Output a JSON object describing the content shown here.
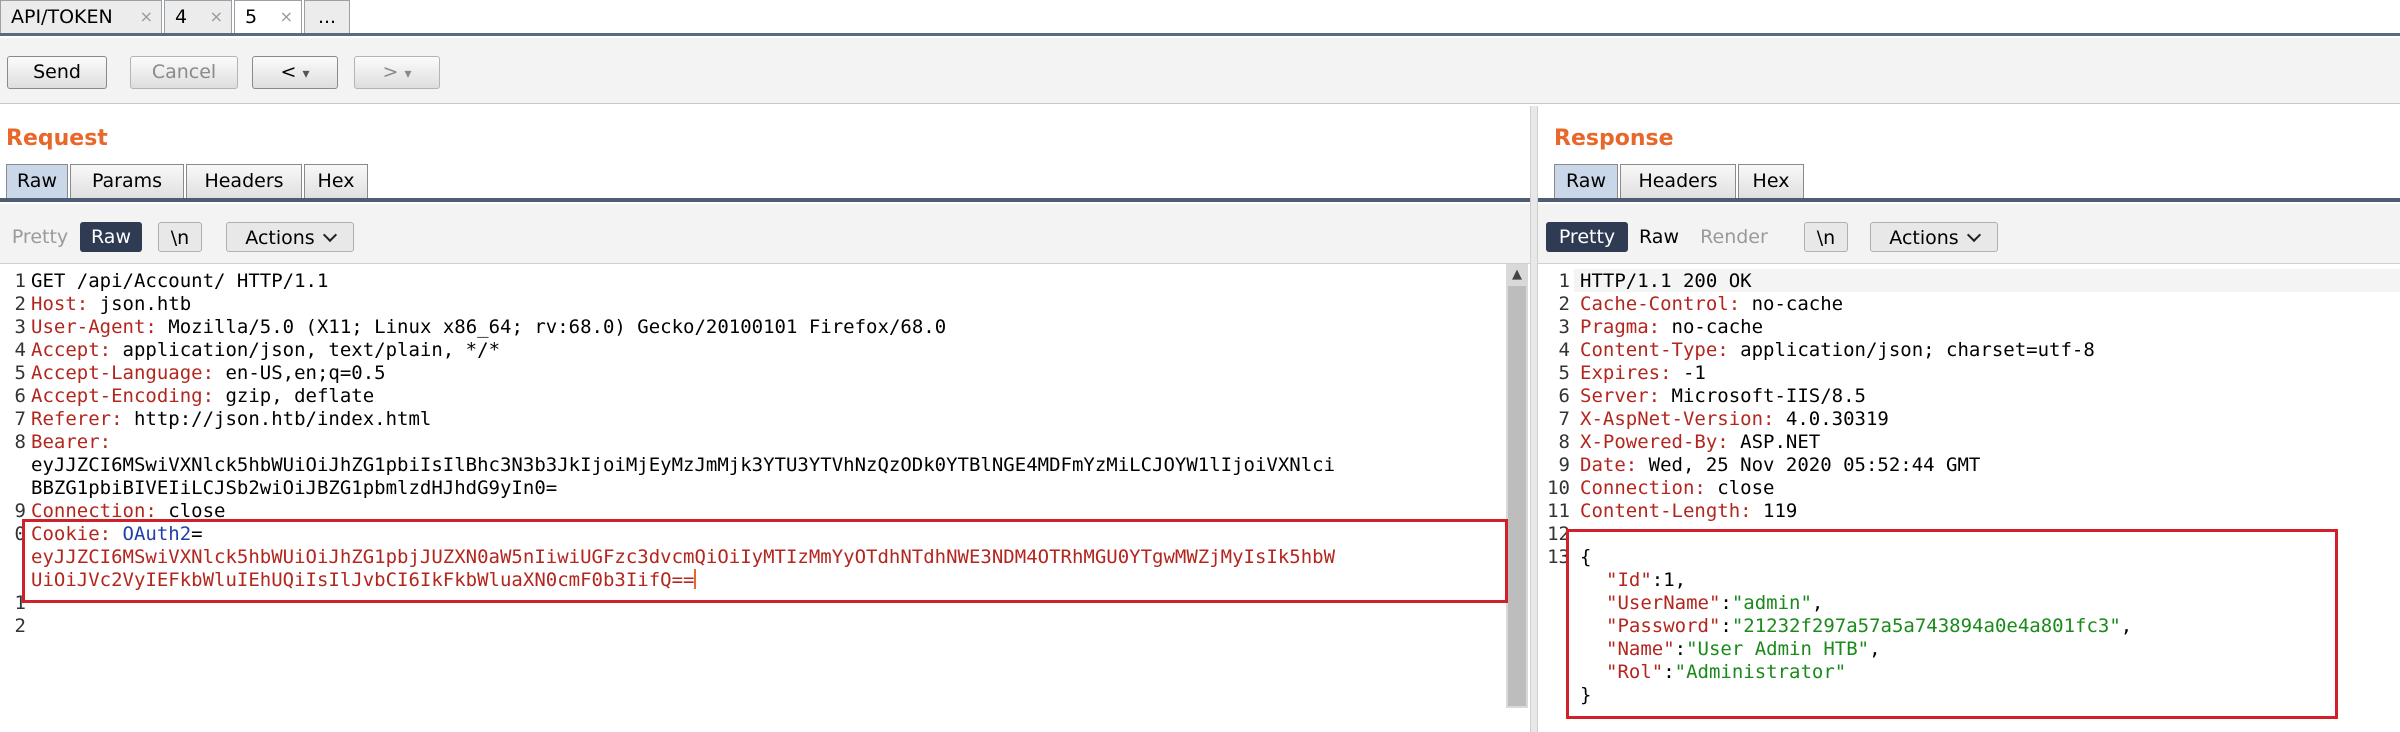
{
  "tabs": [
    {
      "label": "API/TOKEN",
      "close": "×"
    },
    {
      "label": "4",
      "close": "×"
    },
    {
      "label": "5",
      "close": "×"
    },
    {
      "label": "..."
    }
  ],
  "toolbar": {
    "send": "Send",
    "cancel": "Cancel",
    "back": "<",
    "forward": ">",
    "dropdown": "▾"
  },
  "request": {
    "title": "Request",
    "tabs": [
      "Raw",
      "Params",
      "Headers",
      "Hex"
    ],
    "view": {
      "pretty": "Pretty",
      "raw": "Raw",
      "newline": "\\n",
      "actions": "Actions"
    },
    "lines": [
      {
        "n": "1",
        "key": "",
        "val": "GET /api/Account/ HTTP/1.1"
      },
      {
        "n": "2",
        "key": "Host:",
        "val": " json.htb"
      },
      {
        "n": "3",
        "key": "User-Agent:",
        "val": " Mozilla/5.0 (X11; Linux x86_64; rv:68.0) Gecko/20100101 Firefox/68.0"
      },
      {
        "n": "4",
        "key": "Accept:",
        "val": " application/json, text/plain, */*"
      },
      {
        "n": "5",
        "key": "Accept-Language:",
        "val": " en-US,en;q=0.5"
      },
      {
        "n": "6",
        "key": "Accept-Encoding:",
        "val": " gzip, deflate"
      },
      {
        "n": "7",
        "key": "Referer:",
        "val": " http://json.htb/index.html"
      },
      {
        "n": "8",
        "key": "Bearer:",
        "val": ""
      },
      {
        "n": "",
        "key": "",
        "val": "eyJJZCI6MSwiVXNlck5hbWUiOiJhZG1pbiIsIlBhc3N3b3JkIjoiMjEyMzJmMjk3YTU3YTVhNzQzODk0YTBlNGE4MDFmYzMiLCJOYW1lIjoiVXNlci"
      },
      {
        "n": "",
        "key": "",
        "val": "BBZG1pbiBIVEIiLCJSb2wiOiJBZG1pbmlzdHJhdG9yIn0="
      },
      {
        "n": "9",
        "key": "Connection:",
        "val": " close"
      },
      {
        "n": "0",
        "key": "Cookie:",
        "val": " ",
        "cookie_name": "OAuth2",
        "eq": "="
      },
      {
        "n": "",
        "key": "",
        "cookie_val": "eyJJZCI6MSwiVXNlck5hbWUiOiJhZG1pbjJUZXN0aW5nIiwiUGFzc3dvcmQiOiIyMTIzMmYyOTdhNTdhNWE3NDM4OTRhMGU0YTgwMWZjMyIsIk5hbW"
      },
      {
        "n": "",
        "key": "",
        "cookie_val": "UiOiJVc2VyIEFkbWluIEhUQiIsIlJvbCI6IkFkbWluaXN0cmF0b3IifQ=="
      },
      {
        "n": "1",
        "key": "",
        "val": ""
      },
      {
        "n": "2",
        "key": "",
        "val": ""
      }
    ]
  },
  "response": {
    "title": "Response",
    "tabs": [
      "Raw",
      "Headers",
      "Hex"
    ],
    "view": {
      "pretty": "Pretty",
      "raw": "Raw",
      "render": "Render",
      "newline": "\\n",
      "actions": "Actions"
    },
    "lines": [
      {
        "n": "1",
        "key": "",
        "val": "HTTP/1.1 200 OK"
      },
      {
        "n": "2",
        "key": "Cache-Control:",
        "val": " no-cache"
      },
      {
        "n": "3",
        "key": "Pragma:",
        "val": " no-cache"
      },
      {
        "n": "4",
        "key": "Content-Type:",
        "val": " application/json; charset=utf-8"
      },
      {
        "n": "5",
        "key": "Expires:",
        "val": " -1"
      },
      {
        "n": "6",
        "key": "Server:",
        "val": " Microsoft-IIS/8.5"
      },
      {
        "n": "7",
        "key": "X-AspNet-Version:",
        "val": " 4.0.30319"
      },
      {
        "n": "8",
        "key": "X-Powered-By:",
        "val": " ASP.NET"
      },
      {
        "n": "9",
        "key": "Date:",
        "val": " Wed, 25 Nov 2020 05:52:44 GMT"
      },
      {
        "n": "10",
        "key": "Connection:",
        "val": " close"
      },
      {
        "n": "11",
        "key": "Content-Length:",
        "val": " 119"
      },
      {
        "n": "12",
        "key": "",
        "val": ""
      },
      {
        "n": "13",
        "key": "",
        "val": "{"
      }
    ],
    "json": [
      {
        "key": "\"Id\"",
        "sep": ":",
        "val": "1",
        "tail": ","
      },
      {
        "key": "\"UserName\"",
        "sep": ":",
        "val": "\"admin\"",
        "tail": ","
      },
      {
        "key": "\"Password\"",
        "sep": ":",
        "val": "\"21232f297a57a5a743894a0e4a801fc3\"",
        "tail": ","
      },
      {
        "key": "\"Name\"",
        "sep": ":",
        "val": "\"User Admin HTB\"",
        "tail": ","
      },
      {
        "key": "\"Rol\"",
        "sep": ":",
        "val": "\"Administrator\"",
        "tail": ""
      }
    ],
    "close_brace": "}"
  },
  "colors": {
    "accent": "#e8672b",
    "highlight": "#d0202a",
    "key": "#b3261e",
    "string": "#1a8a1a"
  }
}
